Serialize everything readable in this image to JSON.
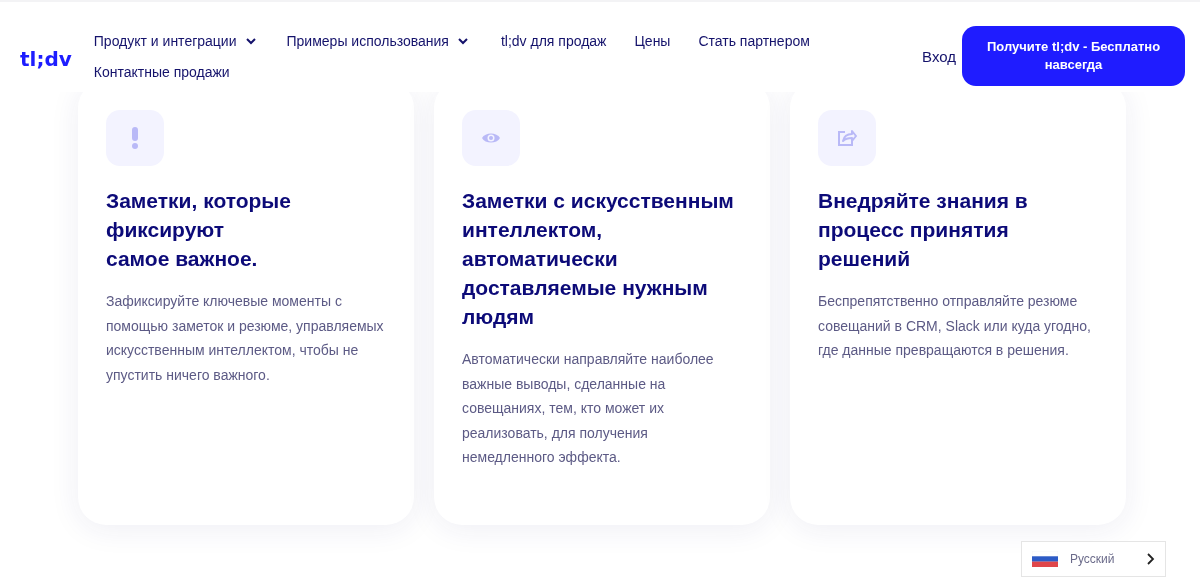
{
  "header": {
    "logo": "tl;dv",
    "nav": [
      {
        "label": "Продукт и интеграции",
        "dropdown": true
      },
      {
        "label": "Примеры использования",
        "dropdown": true
      },
      {
        "label": "tl;dv для продаж",
        "dropdown": false
      },
      {
        "label": "Цены",
        "dropdown": false
      },
      {
        "label": "Стать партнером",
        "dropdown": false
      },
      {
        "label": "Контактные продажи",
        "dropdown": false
      }
    ],
    "login": "Вход",
    "cta": "Получите tl;dv - Бесплатно навсегда"
  },
  "cards": [
    {
      "kind": "exclamation",
      "title": "Заметки, которые фиксируют\nсамое важное.",
      "text": "Зафиксируйте ключевые моменты с помощью заметок и резюме, управляемых искусственным интеллектом, чтобы не упустить ничего важного."
    },
    {
      "kind": "eye",
      "title": "Заметки с искусственным интеллектом, автоматически доставляемые нужным людям",
      "text": "Автоматически направляйте наиболее важные выводы, сделанные на совещаниях, тем, кто может их реализовать, для получения немедленного эффекта."
    },
    {
      "kind": "share",
      "title": "Внедряйте знания в процесс принятия решений",
      "text": "Беспрепятственно отправляйте резюме совещаний в CRM, Slack или куда угодно, где данные превращаются в решения."
    }
  ],
  "language": {
    "label": "Русский"
  }
}
